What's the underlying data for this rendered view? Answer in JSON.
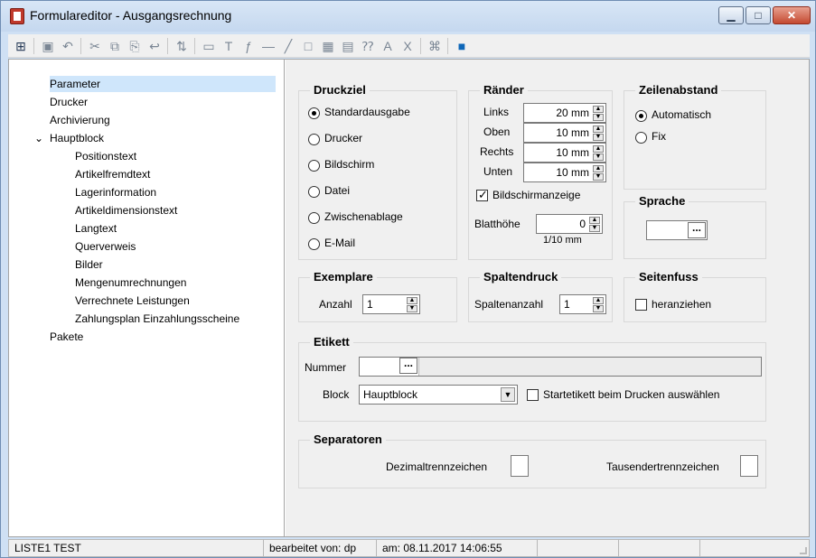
{
  "window": {
    "title": "Formulareditor - Ausgangsrechnung"
  },
  "toolbar": {
    "icons": [
      "tree-view-icon",
      "save-icon",
      "undo-icon",
      "cut-icon",
      "copy-icon",
      "paste-icon",
      "undo-arrow-icon",
      "sort-icon",
      "textfield-icon",
      "text-icon",
      "formula-icon",
      "line-icon",
      "diagonal-line-icon",
      "rectangle-icon",
      "image-icon",
      "document-icon",
      "field-icon",
      "font-icon",
      "clear-format-icon",
      "network-icon",
      "help-book-icon"
    ]
  },
  "tree": {
    "items": [
      {
        "label": "Parameter",
        "level": 1,
        "selected": true
      },
      {
        "label": "Drucker",
        "level": 1
      },
      {
        "label": "Archivierung",
        "level": 1
      },
      {
        "label": "Hauptblock",
        "level": 1,
        "expanded": true
      },
      {
        "label": "Positionstext",
        "level": 2
      },
      {
        "label": "Artikelfremdtext",
        "level": 2
      },
      {
        "label": "Lagerinformation",
        "level": 2
      },
      {
        "label": "Artikeldimensionstext",
        "level": 2
      },
      {
        "label": "Langtext",
        "level": 2
      },
      {
        "label": "Querverweis",
        "level": 2
      },
      {
        "label": "Bilder",
        "level": 2
      },
      {
        "label": "Mengenumrechnungen",
        "level": 2
      },
      {
        "label": "Verrechnete Leistungen",
        "level": 2
      },
      {
        "label": "Zahlungsplan Einzahlungsscheine",
        "level": 2
      },
      {
        "label": "Pakete",
        "level": 1
      }
    ]
  },
  "druckziel": {
    "title": "Druckziel",
    "options": [
      {
        "label": "Standardausgabe",
        "checked": true
      },
      {
        "label": "Drucker",
        "checked": false
      },
      {
        "label": "Bildschirm",
        "checked": false
      },
      {
        "label": "Datei",
        "checked": false
      },
      {
        "label": "Zwischenablage",
        "checked": false
      },
      {
        "label": "E-Mail",
        "checked": false
      }
    ]
  },
  "raender": {
    "title": "Ränder",
    "fields": [
      {
        "label": "Links",
        "value": "20 mm"
      },
      {
        "label": "Oben",
        "value": "10 mm"
      },
      {
        "label": "Rechts",
        "value": "10 mm"
      },
      {
        "label": "Unten",
        "value": "10 mm"
      }
    ],
    "bildschirm_label": "Bildschirmanzeige",
    "bildschirm_checked": true,
    "blatthoehe_label": "Blatthöhe",
    "blatthoehe_value": "0",
    "blatthoehe_unit": "1/10 mm"
  },
  "zeilenabstand": {
    "title": "Zeilenabstand",
    "options": [
      {
        "label": "Automatisch",
        "checked": true
      },
      {
        "label": "Fix",
        "checked": false
      }
    ]
  },
  "sprache": {
    "title": "Sprache",
    "value": "",
    "button": "..."
  },
  "exemplare": {
    "title": "Exemplare",
    "anzahl_label": "Anzahl",
    "anzahl_value": "1"
  },
  "spaltendruck": {
    "title": "Spaltendruck",
    "spaltenanzahl_label": "Spaltenanzahl",
    "spaltenanzahl_value": "1"
  },
  "seitenfuss": {
    "title": "Seitenfuss",
    "heranziehen_label": "heranziehen",
    "checked": false
  },
  "etikett": {
    "title": "Etikett",
    "nummer_label": "Nummer",
    "nummer_value": "",
    "button": "...",
    "block_label": "Block",
    "block_value": "Hauptblock",
    "startetikett_label": "Startetikett beim Drucken auswählen",
    "startetikett_checked": false
  },
  "separatoren": {
    "title": "Separatoren",
    "dezimal_label": "Dezimaltrennzeichen",
    "dezimal_value": "",
    "tausender_label": "Tausendertrennzeichen",
    "tausender_value": ""
  },
  "status": {
    "left": "LISTE1 TEST",
    "bearbeitet": "bearbeitet von: dp",
    "am": "am: 08.11.2017 14:06:55"
  },
  "colors": {
    "title_gradient_top": "#d8e6f6",
    "selected_tree_bg": "#cfe6fb",
    "pane_bg": "#f0f0f0",
    "close_button": "#c44a31"
  }
}
